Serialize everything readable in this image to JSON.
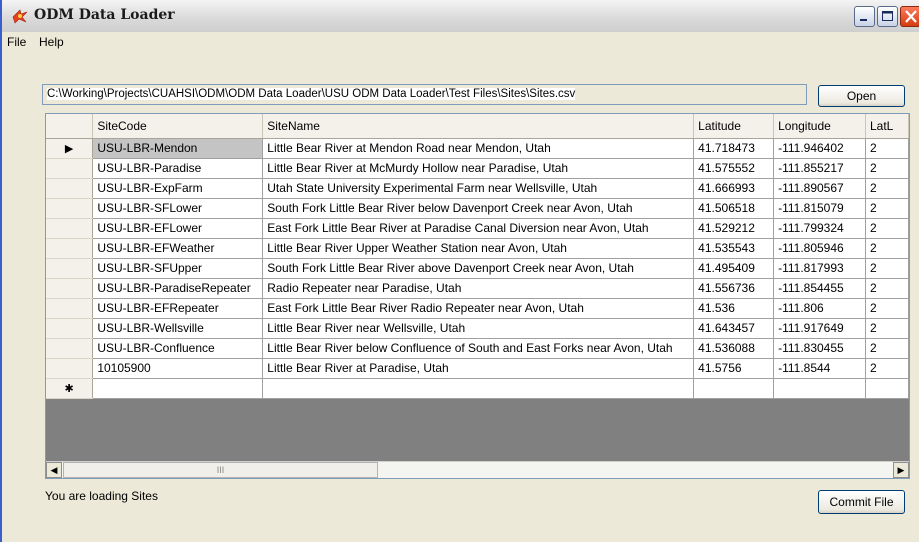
{
  "window": {
    "title": "ODM Data Loader",
    "controls": {
      "minimize": "_",
      "maximize": "□",
      "close": "✕"
    }
  },
  "menu": [
    {
      "label": "File"
    },
    {
      "label": "Help"
    }
  ],
  "file_path": {
    "value": "C:\\Working\\Projects\\CUAHSI\\ODM\\ODM Data Loader\\USU ODM Data Loader\\Test Files\\Sites\\Sites.csv"
  },
  "buttons": {
    "open": "Open",
    "commit": "Commit File"
  },
  "grid": {
    "columns": [
      "SiteCode",
      "SiteName",
      "Latitude",
      "Longitude",
      "LatL"
    ],
    "rows": [
      [
        "USU-LBR-Mendon",
        "Little Bear River at Mendon Road near Mendon, Utah",
        "41.718473",
        "-111.946402",
        "2"
      ],
      [
        "USU-LBR-Paradise",
        "Little Bear River at McMurdy Hollow near Paradise, Utah",
        "41.575552",
        "-111.855217",
        "2"
      ],
      [
        "USU-LBR-ExpFarm",
        "Utah State University Experimental Farm near Wellsville, Utah",
        "41.666993",
        "-111.890567",
        "2"
      ],
      [
        "USU-LBR-SFLower",
        "South Fork Little Bear River below Davenport Creek near Avon, Utah",
        "41.506518",
        "-111.815079",
        "2"
      ],
      [
        "USU-LBR-EFLower",
        "East Fork Little Bear River at Paradise Canal Diversion near Avon, Utah",
        "41.529212",
        "-111.799324",
        "2"
      ],
      [
        "USU-LBR-EFWeather",
        "Little Bear River Upper Weather Station near Avon, Utah",
        "41.535543",
        "-111.805946",
        "2"
      ],
      [
        "USU-LBR-SFUpper",
        "South Fork Little Bear River above Davenport Creek near Avon, Utah",
        "41.495409",
        "-111.817993",
        "2"
      ],
      [
        "USU-LBR-ParadiseRepeater",
        "Radio Repeater near Paradise, Utah",
        "41.556736",
        "-111.854455",
        "2"
      ],
      [
        "USU-LBR-EFRepeater",
        "East Fork Little Bear River Radio Repeater near Avon, Utah",
        "41.536",
        "-111.806",
        "2"
      ],
      [
        "USU-LBR-Wellsville",
        "Little Bear River near Wellsville, Utah",
        "41.643457",
        "-111.917649",
        "2"
      ],
      [
        "USU-LBR-Confluence",
        "Little Bear River below Confluence of South and East Forks near Avon, Utah",
        "41.536088",
        "-111.830455",
        "2"
      ],
      [
        "10105900",
        "Little Bear River at Paradise, Utah",
        "41.5756",
        "-111.8544",
        "2"
      ]
    ],
    "current_row_marker": "▶",
    "new_row_marker": "✱",
    "scroll_left": "◀",
    "scroll_right": "▶",
    "thumb_grip": "III"
  },
  "status_text": "You are loading Sites"
}
